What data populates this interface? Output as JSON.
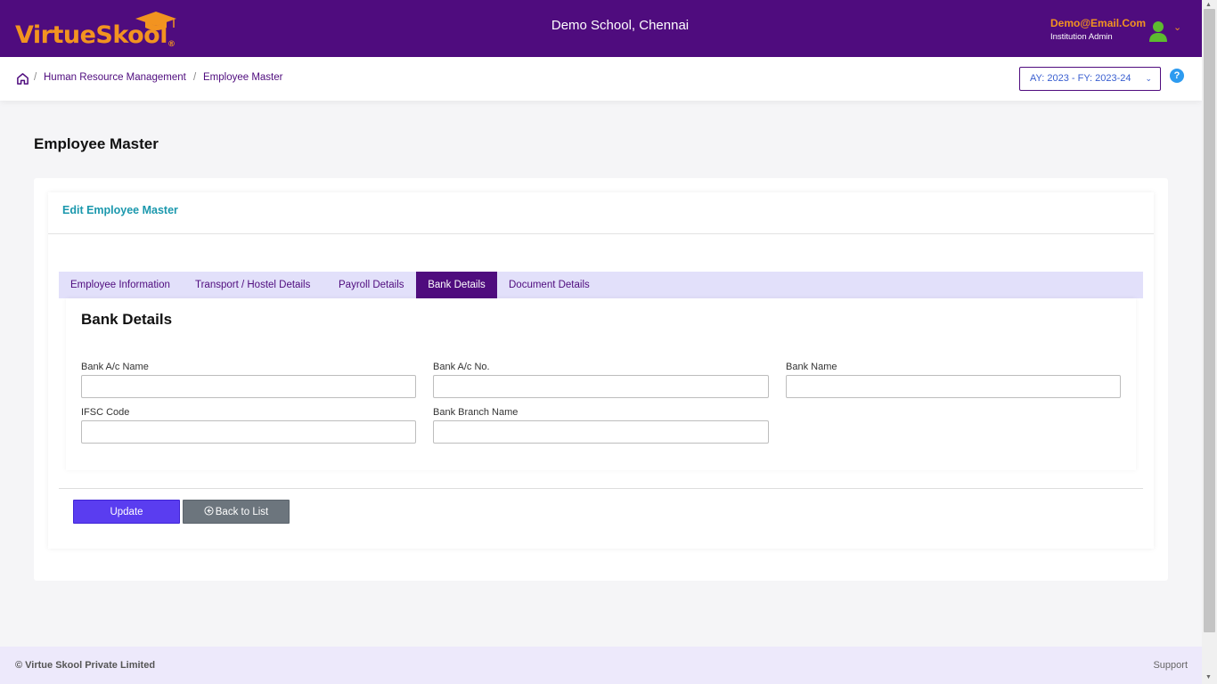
{
  "header": {
    "logo_text": "VirtueSkool",
    "logo_mark": "®",
    "school_name": "Demo School, Chennai",
    "user_email": "Demo@Email.Com",
    "user_role": "Institution Admin"
  },
  "breadcrumb": {
    "items": [
      "Human Resource Management",
      "Employee Master"
    ],
    "separator": "/"
  },
  "year_select": {
    "value": "AY: 2023 - FY: 2023-24"
  },
  "help_label": "?",
  "page_title": "Employee Master",
  "card_title": "Edit Employee Master",
  "tabs": [
    {
      "label": "Employee Information",
      "active": false
    },
    {
      "label": "Transport / Hostel Details",
      "active": false
    },
    {
      "label": "Payroll Details",
      "active": false
    },
    {
      "label": "Bank Details",
      "active": true
    },
    {
      "label": "Document Details",
      "active": false
    }
  ],
  "section_title": "Bank Details",
  "fields": {
    "bank_ac_name": {
      "label": "Bank A/c Name",
      "value": ""
    },
    "bank_ac_no": {
      "label": "Bank A/c No.",
      "value": ""
    },
    "bank_name": {
      "label": "Bank Name",
      "value": ""
    },
    "ifsc_code": {
      "label": "IFSC Code",
      "value": ""
    },
    "bank_branch": {
      "label": "Bank Branch Name",
      "value": ""
    }
  },
  "buttons": {
    "update": "Update",
    "back": "Back to List"
  },
  "footer": {
    "copyright": "© Virtue Skool Private Limited",
    "support": "Support"
  },
  "colors": {
    "brand_purple": "#4f0c7e",
    "brand_orange": "#f29320",
    "accent_teal": "#1b98ad",
    "update_button": "#5a3df0",
    "back_button": "#6c757d"
  },
  "icons": [
    "graduation-cap-icon",
    "user-avatar-icon",
    "chevron-down-icon",
    "home-icon",
    "help-icon",
    "back-circle-icon"
  ]
}
